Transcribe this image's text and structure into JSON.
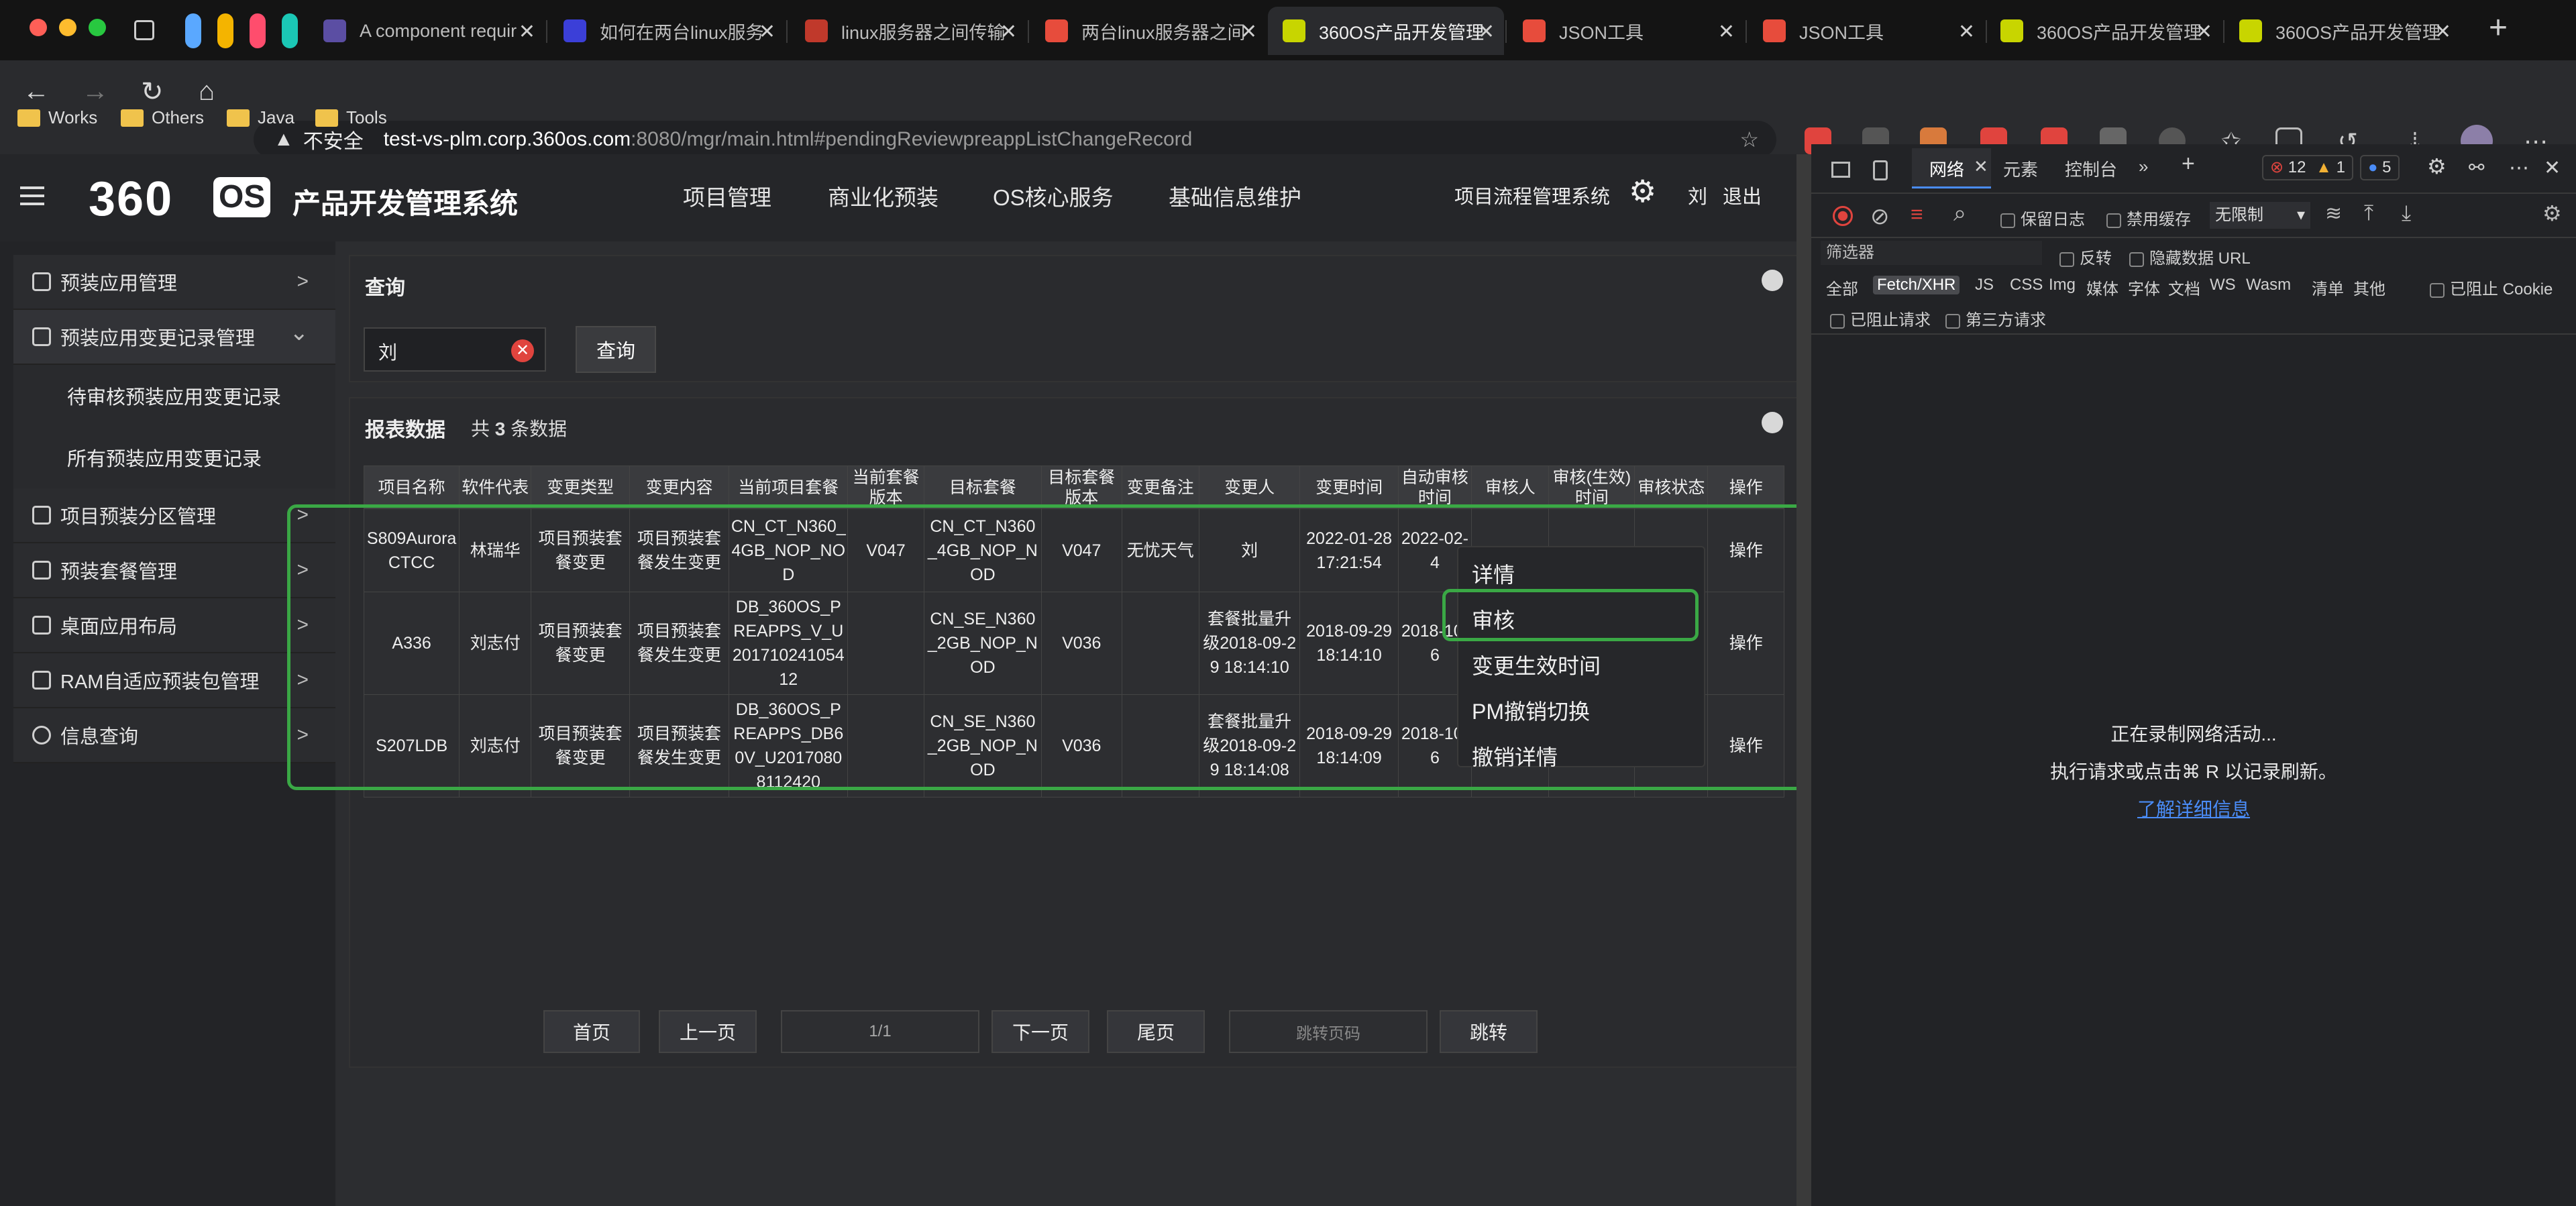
{
  "browser": {
    "tabs": [
      {
        "title": "A component requir",
        "fav_color": "#5b4ea3"
      },
      {
        "title": "如何在两台linux服务",
        "fav_color": "#3b3fd8"
      },
      {
        "title": "linux服务器之间传输",
        "fav_color": "#c0392b"
      },
      {
        "title": "两台linux服务器之间",
        "fav_color": "#e74c3c"
      },
      {
        "title": "360OS产品开发管理",
        "fav_color": "#c8d500"
      },
      {
        "title": "JSON工具",
        "fav_color": "#e74c3c"
      },
      {
        "title": "JSON工具",
        "fav_color": "#e74c3c"
      },
      {
        "title": "360OS产品开发管理",
        "fav_color": "#c8d500"
      },
      {
        "title": "360OS产品开发管理",
        "fav_color": "#c8d500"
      }
    ],
    "close_glyph": "✕",
    "new_tab_glyph": "+",
    "insecure_label": "不安全",
    "url_host": "test-vs-plm.corp.360os.com",
    "url_rest": ":8080/mgr/main.html#pendingReviewpreappListChangeRecord",
    "bookmarks": [
      "Works",
      "Others",
      "Java",
      "Tools"
    ]
  },
  "app": {
    "logo_num": "360",
    "logo_os": "OS",
    "logo_title": "产品开发管理系统",
    "nav": [
      "项目管理",
      "商业化预装",
      "OS核心服务",
      "基础信息维护"
    ],
    "flow_system": "项目流程管理系统",
    "user": "刘",
    "logout": "退出"
  },
  "sidebar": {
    "items": [
      {
        "label": "预装应用管理",
        "chevron": ">"
      },
      {
        "label": "预装应用变更记录管理",
        "chevron": "⌄"
      },
      {
        "label": "项目预装分区管理",
        "chevron": ">"
      },
      {
        "label": "预装套餐管理",
        "chevron": ">"
      },
      {
        "label": "桌面应用布局",
        "chevron": ">"
      },
      {
        "label": "RAM自适应预装包管理",
        "chevron": ">"
      },
      {
        "label": "信息查询",
        "chevron": ">"
      }
    ],
    "subitems": [
      "待审核预装应用变更记录",
      "所有预装应用变更记录"
    ]
  },
  "query": {
    "title": "查询",
    "input_value": "刘",
    "button": "查询"
  },
  "report": {
    "title": "报表数据",
    "count_prefix": "共",
    "count": "3",
    "count_suffix": "条数据",
    "headers": [
      "项目名称",
      "软件代表",
      "变更类型",
      "变更内容",
      "当前项目套餐",
      "当前套餐版本",
      "目标套餐",
      "目标套餐版本",
      "变更备注",
      "变更人",
      "变更时间",
      "自动审核时间",
      "审核人",
      "审核(生效)时间",
      "审核状态",
      "操作"
    ],
    "rows": [
      [
        "S809Aurora CTCC",
        "林瑞华",
        "项目预装套餐变更",
        "项目预装套餐发生变更",
        "CN_CT_N360_4GB_NOP_NOD",
        "V047",
        "CN_CT_N360_4GB_NOP_NOD",
        "V047",
        "无忧天气",
        "刘",
        "2022-01-28 17:21:54",
        "2022-02-4",
        "",
        "",
        "",
        "操作"
      ],
      [
        "A336",
        "刘志付",
        "项目预装套餐变更",
        "项目预装套餐发生变更",
        "DB_360OS_PREAPPS_V_U20171024105412",
        "",
        "CN_SE_N360_2GB_NOP_NOD",
        "V036",
        "",
        "套餐批量升级2018-09-29 18:14:10",
        "2018-09-29 18:14:10",
        "2018-10-6",
        "",
        "",
        "",
        "操作"
      ],
      [
        "S207LDB",
        "刘志付",
        "项目预装套餐变更",
        "项目预装套餐发生变更",
        "DB_360OS_PREAPPS_DB60V_U20170808112420",
        "",
        "CN_SE_N360_2GB_NOP_NOD",
        "V036",
        "",
        "套餐批量升级2018-09-29 18:14:08",
        "2018-09-29 18:14:09",
        "2018-10-6",
        "",
        "",
        "",
        "操作"
      ]
    ]
  },
  "pager": {
    "first": "首页",
    "prev": "上一页",
    "page": "1/1",
    "next": "下一页",
    "last": "尾页",
    "jump_placeholder": "跳转页码",
    "jump": "跳转"
  },
  "context_menu": [
    "详情",
    "审核",
    "变更生效时间",
    "PM撤销切换",
    "撤销详情"
  ],
  "devtools": {
    "tabs": [
      "网络",
      "元素",
      "控制台"
    ],
    "errors": "12",
    "warnings": "1",
    "infos": "5",
    "preserve_log": "保留日志",
    "disable_cache": "禁用缓存",
    "throttle": "无限制",
    "filter_placeholder": "筛选器",
    "invert": "反转",
    "hide_data_url": "隐藏数据 URL",
    "types": [
      "全部",
      "Fetch/XHR",
      "JS",
      "CSS",
      "Img",
      "媒体",
      "字体",
      "文档",
      "WS",
      "Wasm",
      "清单",
      "其他"
    ],
    "blocked_cookies": "已阻止 Cookie",
    "blocked_requests": "已阻止请求",
    "third_party": "第三方请求",
    "recording": "正在录制网络活动...",
    "hint": "执行请求或点击⌘ R 以记录刷新。",
    "learn_more": "了解详细信息"
  },
  "colors": {
    "highlight_green": "#3aa845",
    "accent_blue": "#4a8cf7",
    "error_red": "#e0443e"
  }
}
